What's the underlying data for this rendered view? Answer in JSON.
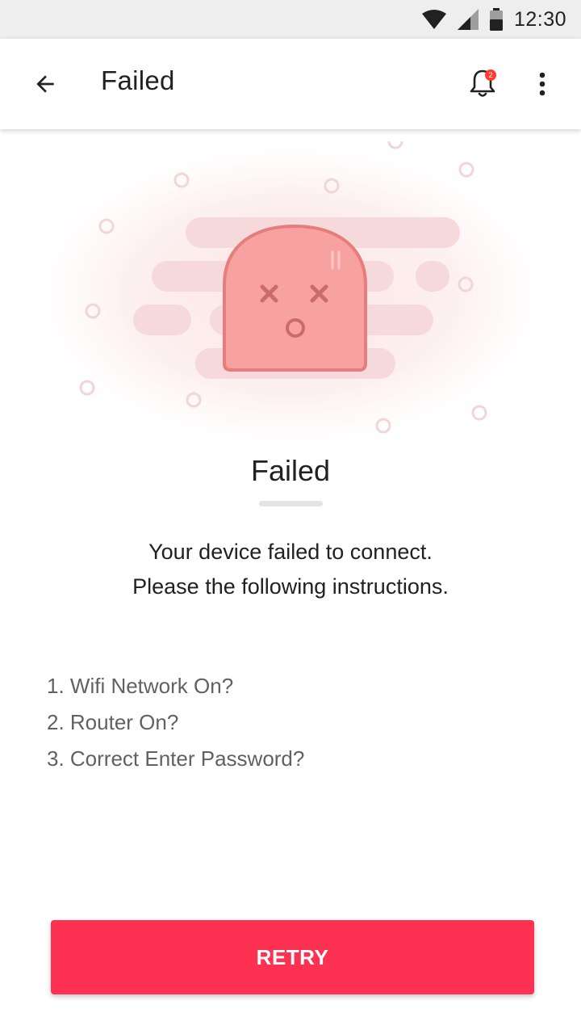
{
  "status_bar": {
    "time": "12:30",
    "icons": [
      "wifi-icon",
      "cell-signal-icon",
      "battery-icon"
    ]
  },
  "app_bar": {
    "title": "Failed",
    "back_icon": "arrow-back-icon",
    "notification_icon": "bell-icon",
    "notification_count": "2",
    "more_icon": "more-vert-icon"
  },
  "main": {
    "heading": "Failed",
    "message_line1": "Your device failed to connect.",
    "message_line2": "Please the following instructions.",
    "instructions": [
      "1. Wifi Network On?",
      "2. Router On?",
      "3. Correct Enter Password?"
    ],
    "retry_label": "RETRY"
  },
  "colors": {
    "accent": "#fd3152",
    "character_body": "#f8a1a1",
    "character_outline": "#e57d7d",
    "background": "#ffffff"
  }
}
